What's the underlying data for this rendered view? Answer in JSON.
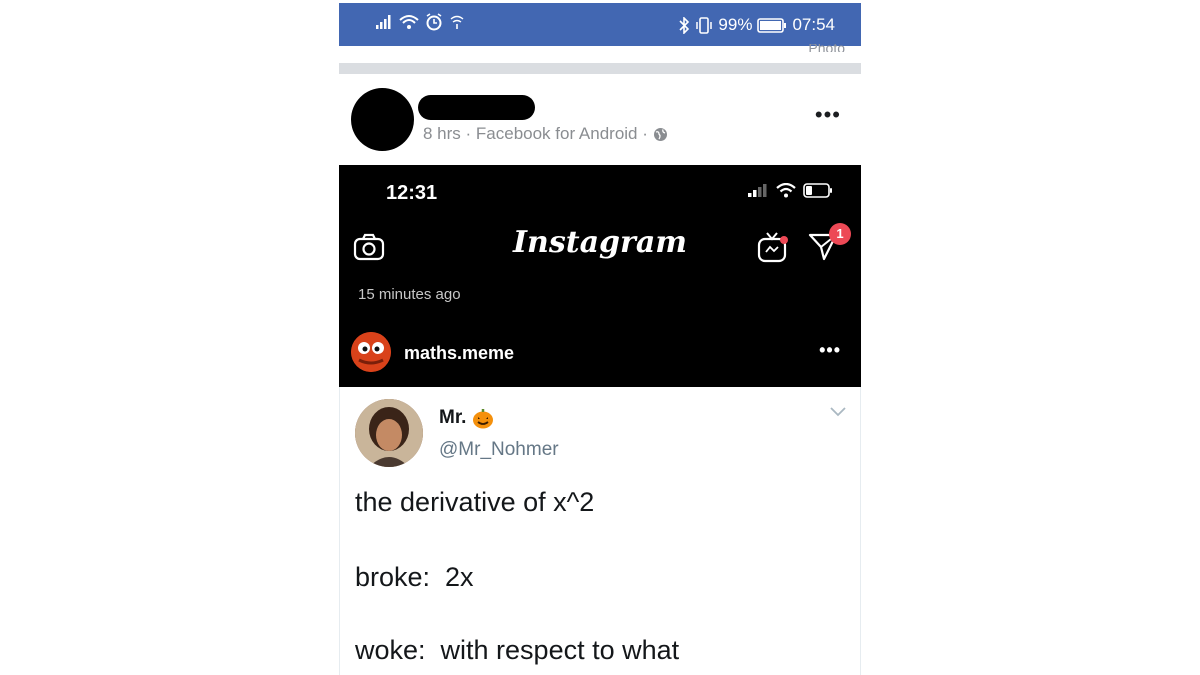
{
  "status_bar": {
    "battery": "99%",
    "time": "07:54",
    "left_icons": [
      "signal-icon",
      "wifi-icon",
      "alarm-icon",
      "hotspot-icon"
    ],
    "right_icons": [
      "bluetooth-icon",
      "vibrate-icon",
      "battery-icon"
    ],
    "bg_color": "#4267b2"
  },
  "prev_post_cutoff": "Photo",
  "post": {
    "meta": "8 hrs · Facebook for Android ·",
    "more": "•••"
  },
  "instagram_screenshot": {
    "time": "12:31",
    "logo": "Instagram",
    "dm_badge": "1",
    "ago": "15 minutes ago",
    "username": "maths.meme",
    "more": "•••"
  },
  "tweet": {
    "name": "Mr.",
    "handle": "@Mr_Nohmer",
    "line1": "the derivative of x^2",
    "line2": "broke:  2x",
    "line3": "woke:  with respect to what"
  }
}
